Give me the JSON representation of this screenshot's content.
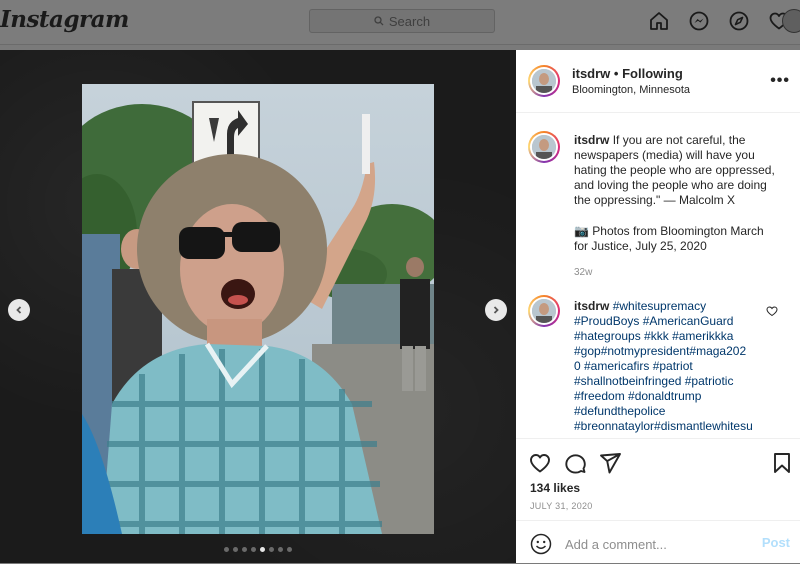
{
  "nav": {
    "logo": "Instagram",
    "search_placeholder": "Search",
    "icons": [
      "home-icon",
      "messenger-icon",
      "explore-icon",
      "heart-icon"
    ]
  },
  "post": {
    "username": "itsdrw",
    "separator": "•",
    "follow_status": "Following",
    "location": "Bloomington, Minnesota",
    "more": "•••",
    "caption_user": "itsdrw",
    "caption_text": "If you are not careful, the newspapers (media) will have you hating the people who are oppressed, and loving the people who are doing the oppressing.\" — Malcolm X",
    "caption_photo_note": "📷 Photos from Bloomington March for Justice, July 25, 2020",
    "caption_age": "32w",
    "comment_user": "itsdrw",
    "comment_tags": [
      "#whitesupremacy",
      "#ProudBoys #AmericanGuard",
      "#hategroups #kkk #amerikkka",
      "#gop#notmypresident#maga202",
      "0 #americafirs #patriot",
      "#shallnotbeinfringed #patriotic",
      "#freedom #donaldtrump",
      "#defundthepolice",
      "#breonnataylor#dismantlewhitesu"
    ],
    "likes": "134 likes",
    "date": "JULY 31, 2020",
    "comment_placeholder": "Add a comment...",
    "post_button": "Post"
  },
  "carousel": {
    "total": 8,
    "active": 5
  },
  "colors": {
    "link": "#00376b",
    "muted": "#8e8e8e",
    "post_button": "#b2dffc"
  }
}
